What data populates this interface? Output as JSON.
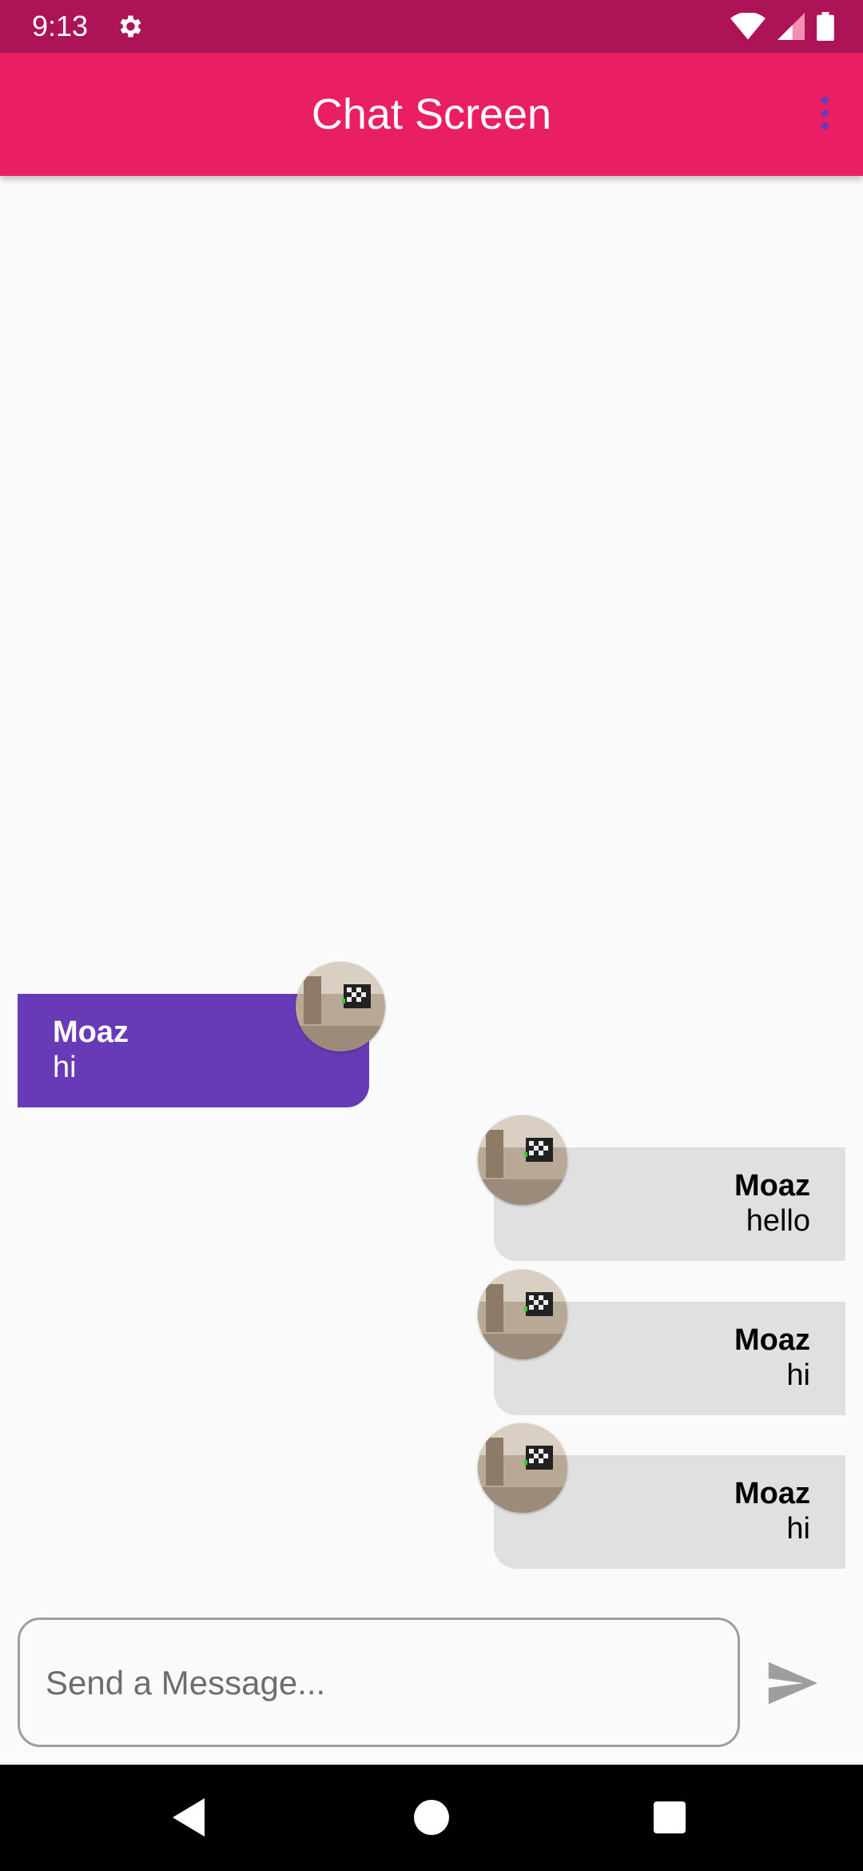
{
  "status_bar": {
    "time": "9:13"
  },
  "app_bar": {
    "title": "Chat Screen"
  },
  "messages": [
    {
      "name": "Moaz",
      "text": "hi",
      "side": "left"
    },
    {
      "name": "Moaz",
      "text": "hello",
      "side": "right"
    },
    {
      "name": "Moaz",
      "text": "hi",
      "side": "right"
    },
    {
      "name": "Moaz",
      "text": "hi",
      "side": "right"
    }
  ],
  "composer": {
    "placeholder": "Send a Message..."
  },
  "icons": {
    "status_settings": "gear-icon",
    "wifi": "wifi-icon",
    "signal": "signal-icon",
    "battery": "battery-icon",
    "overflow": "more-vert-icon",
    "send": "send-icon",
    "nav_back": "back-icon",
    "nav_home": "home-icon",
    "nav_recents": "recents-icon"
  },
  "colors": {
    "status_bar": "#ad1457",
    "app_bar": "#e91e63",
    "own_bubble": "#673ab7",
    "other_bubble": "#e0e0e0"
  }
}
